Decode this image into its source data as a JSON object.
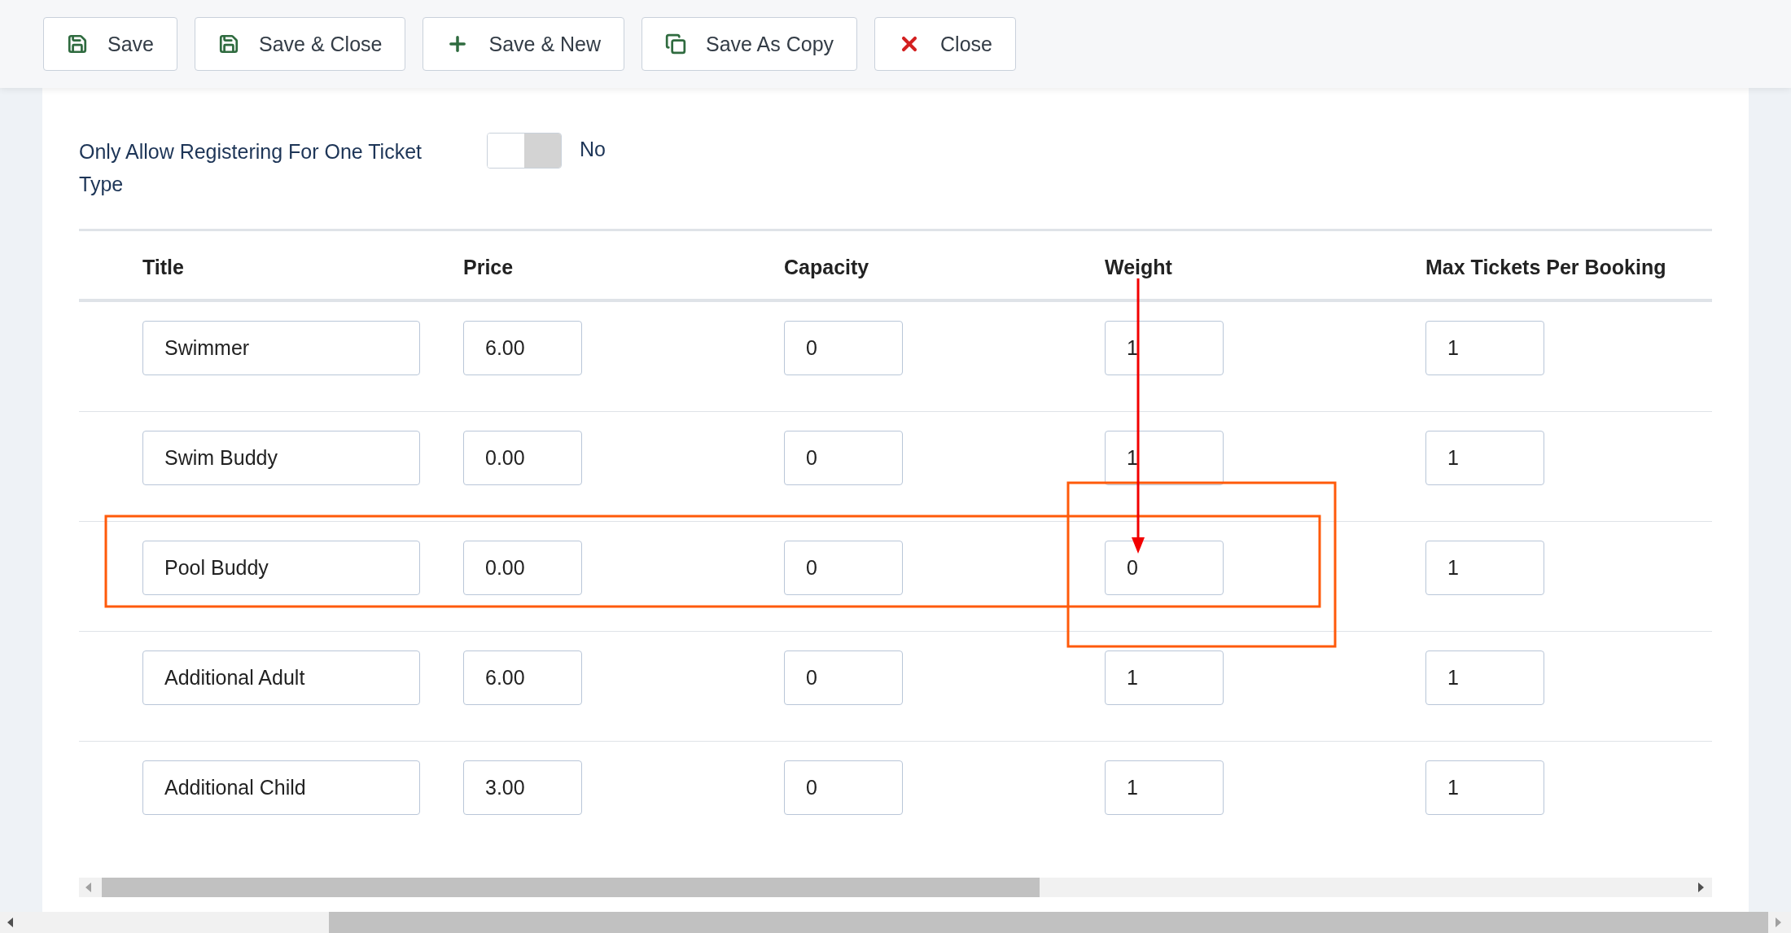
{
  "toolbar": {
    "buttons": [
      {
        "label": "Save",
        "kind": "save"
      },
      {
        "label": "Save & Close",
        "kind": "save"
      },
      {
        "label": "Save & New",
        "kind": "new"
      },
      {
        "label": "Save As Copy",
        "kind": "copy"
      },
      {
        "label": "Close",
        "kind": "close"
      }
    ]
  },
  "settings": [
    {
      "label": "Only Allow Registering For One Ticket Type",
      "on": false,
      "value": "No"
    }
  ],
  "table": {
    "columns": [
      "Title",
      "Price",
      "Capacity",
      "Weight",
      "Max Tickets Per Booking"
    ],
    "rows": [
      [
        "Swimmer",
        "6.00",
        "0",
        "1",
        "1"
      ],
      [
        "Swim Buddy",
        "0.00",
        "0",
        "1",
        "1"
      ],
      [
        "Pool Buddy",
        "0.00",
        "0",
        "0",
        "1"
      ],
      [
        "Additional Adult",
        "6.00",
        "0",
        "1",
        "1"
      ],
      [
        "Additional Child",
        "3.00",
        "0",
        "1",
        "1"
      ]
    ]
  }
}
